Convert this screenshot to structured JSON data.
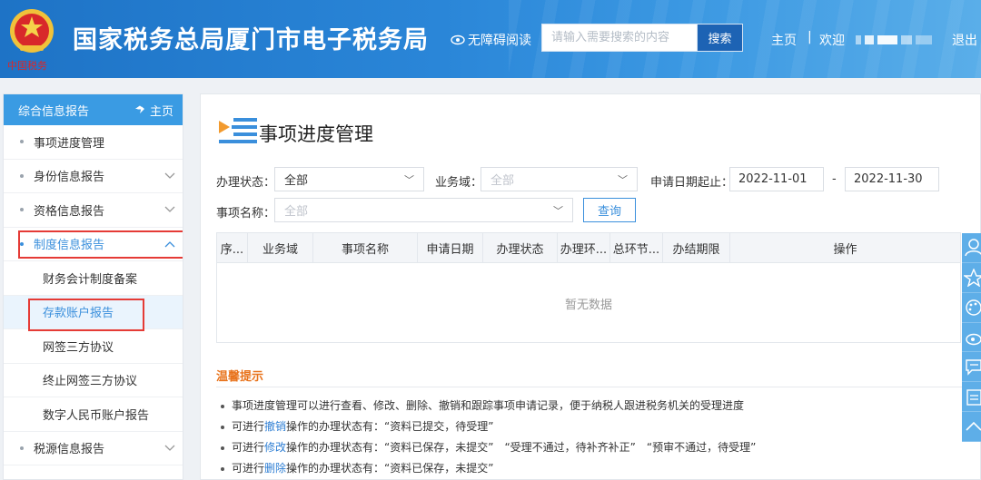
{
  "header": {
    "site_title": "国家税务总局厦门市电子税务局",
    "emblem_caption": "中国税务",
    "accessibility_label": "无障碍阅读",
    "search_placeholder": "请输入需要搜索的内容",
    "search_button": "搜索",
    "home_link": "主页",
    "separator": "|",
    "welcome": "欢迎",
    "logout": "退出"
  },
  "sidebar": {
    "title": "综合信息报告",
    "home_label": "主页",
    "items": [
      {
        "label": "事项进度管理"
      },
      {
        "label": "身份信息报告"
      },
      {
        "label": "资格信息报告"
      },
      {
        "label": "制度信息报告"
      },
      {
        "label": "税源信息报告"
      }
    ],
    "sub_items": [
      {
        "label": "财务会计制度备案"
      },
      {
        "label": "存款账户报告"
      },
      {
        "label": "网签三方协议"
      },
      {
        "label": "终止网签三方协议"
      },
      {
        "label": "数字人民币账户报告"
      }
    ]
  },
  "main": {
    "title": "事项进度管理",
    "filters": {
      "status_label": "办理状态：",
      "status_value": "全部",
      "domain_label": "业务域：",
      "domain_placeholder": "全部",
      "date_label": "申请日期起止：",
      "date_start": "2022-11-01",
      "date_sep": "-",
      "date_end": "2022-11-30",
      "item_label": "事项名称：",
      "item_placeholder": "全部",
      "query_button": "查询"
    },
    "table": {
      "columns": [
        "序...",
        "业务域",
        "事项名称",
        "申请日期",
        "办理状态",
        "办理环...",
        "总环节...",
        "办结期限",
        "操作"
      ],
      "empty_text": "暂无数据"
    },
    "tips": {
      "title": "温馨提示",
      "line1": "事项进度管理可以进行查看、修改、删除、撤销和跟踪事项申请记录，便于纳税人跟进税务机关的受理进度",
      "line2_pre": "可进行",
      "line2_link": "撤销",
      "line2_post": "操作的办理状态有：“资料已提交，待受理”",
      "line3_pre": "可进行",
      "line3_link": "修改",
      "line3_post": "操作的办理状态有：“资料已保存，未提交”　“受理不通过，待补齐补正”　“预审不通过，待受理”",
      "line4_pre": "可进行",
      "line4_link": "删除",
      "line4_post": "操作的办理状态有：“资料已保存，未提交”"
    }
  },
  "colors": {
    "header_blue": "#2a86d8",
    "sidebar_head": "#3a9be3",
    "highlight_red": "#e53b36",
    "link_blue": "#2f7fd4",
    "tips_orange": "#e8731c"
  },
  "icons": {
    "accessibility": "eye-icon",
    "sidebar_home": "home-icon",
    "page_title": "list-play-icon",
    "float_bar": [
      "user-icon",
      "star-icon",
      "palette-icon",
      "weibo-icon",
      "message-icon",
      "clipboard-icon",
      "arrow-up-icon"
    ]
  }
}
